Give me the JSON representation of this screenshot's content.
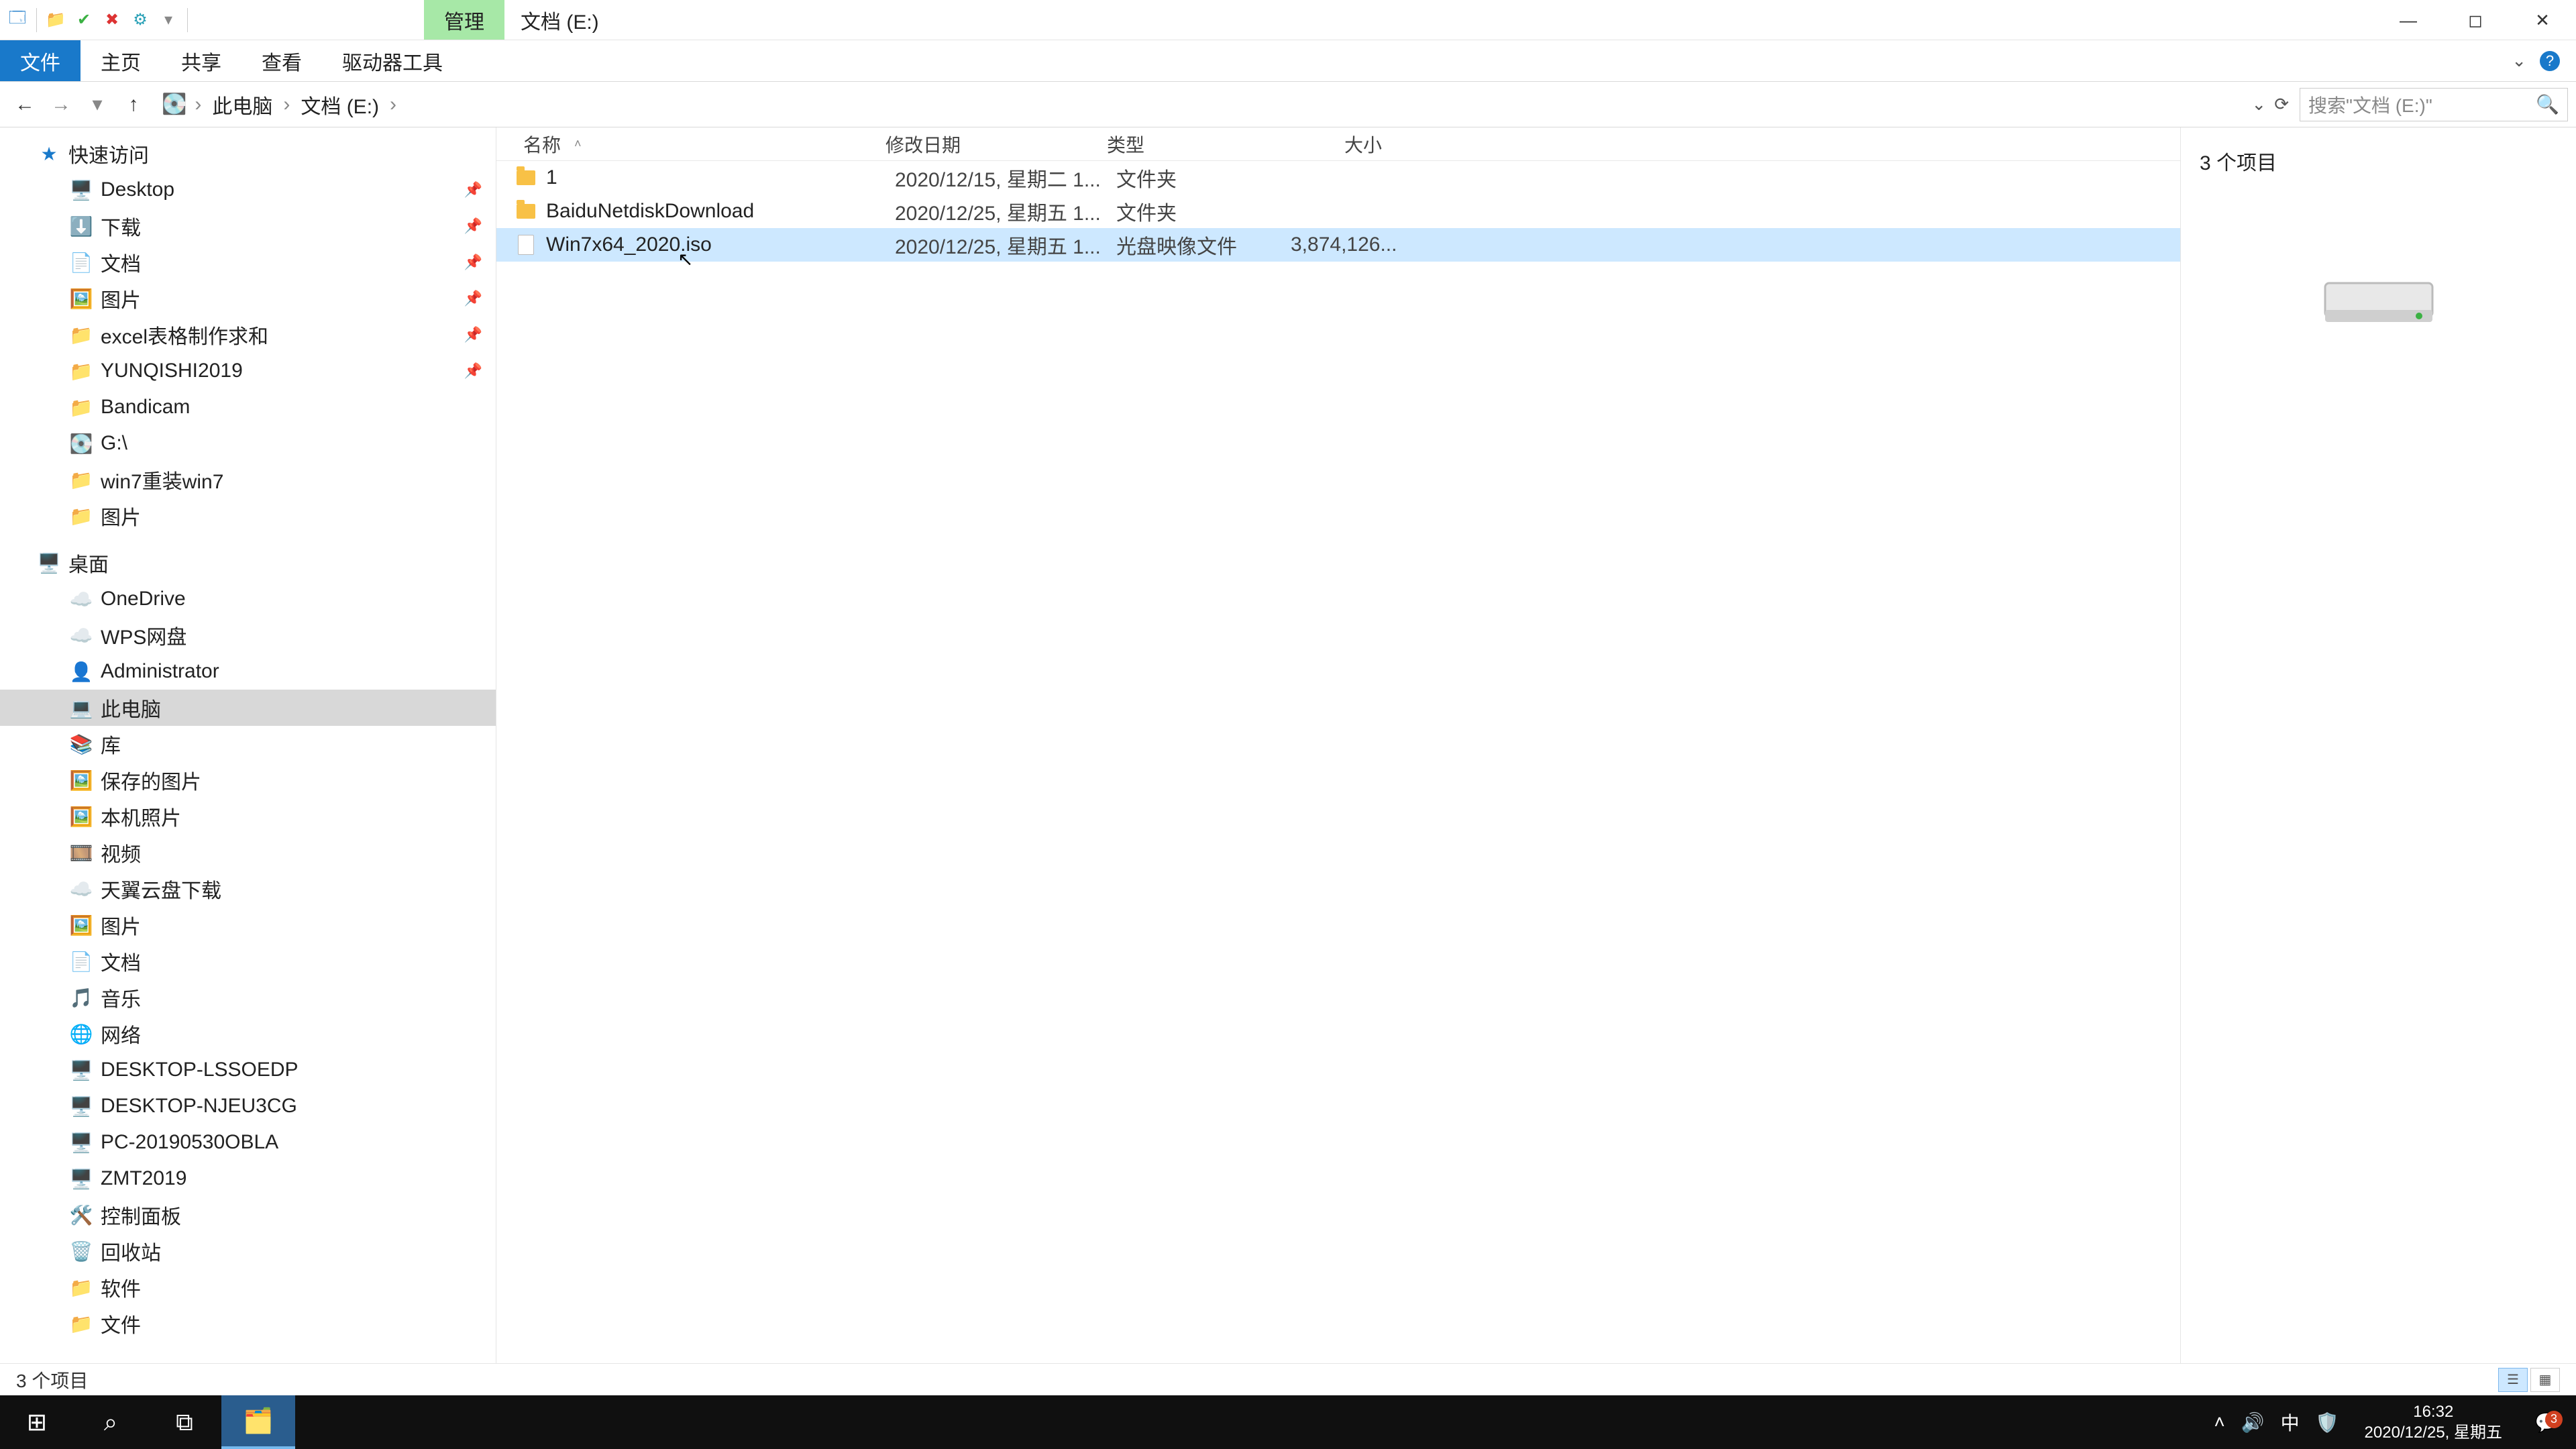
{
  "titlebar": {
    "context_tab": "管理",
    "location": "文档 (E:)"
  },
  "ribbon": {
    "file": "文件",
    "tabs": [
      "主页",
      "共享",
      "查看",
      "驱动器工具"
    ]
  },
  "nav": {
    "crumbs": [
      "此电脑",
      "文档 (E:)"
    ]
  },
  "search": {
    "placeholder": "搜索\"文档 (E:)\""
  },
  "tree": {
    "quick_access": "快速访问",
    "qa_items": [
      {
        "label": "Desktop",
        "icon": "🖥️",
        "pinned": true
      },
      {
        "label": "下载",
        "icon": "⬇️",
        "pinned": true
      },
      {
        "label": "文档",
        "icon": "📄",
        "pinned": true
      },
      {
        "label": "图片",
        "icon": "🖼️",
        "pinned": true
      },
      {
        "label": "excel表格制作求和",
        "icon": "📁",
        "pinned": true
      },
      {
        "label": "YUNQISHI2019",
        "icon": "📁",
        "pinned": true
      },
      {
        "label": "Bandicam",
        "icon": "📁",
        "pinned": false
      },
      {
        "label": "G:\\",
        "icon": "💽",
        "pinned": false
      },
      {
        "label": "win7重装win7",
        "icon": "📁",
        "pinned": false
      },
      {
        "label": "图片",
        "icon": "📁",
        "pinned": false
      }
    ],
    "desktop": "桌面",
    "desktop_items": [
      {
        "label": "OneDrive",
        "icon": "☁️"
      },
      {
        "label": "WPS网盘",
        "icon": "☁️"
      },
      {
        "label": "Administrator",
        "icon": "👤"
      },
      {
        "label": "此电脑",
        "icon": "💻",
        "selected": true
      },
      {
        "label": "库",
        "icon": "📚"
      }
    ],
    "lib_items": [
      {
        "label": "保存的图片",
        "icon": "🖼️"
      },
      {
        "label": "本机照片",
        "icon": "🖼️"
      },
      {
        "label": "视频",
        "icon": "🎞️"
      },
      {
        "label": "天翼云盘下载",
        "icon": "☁️"
      },
      {
        "label": "图片",
        "icon": "🖼️"
      },
      {
        "label": "文档",
        "icon": "📄"
      },
      {
        "label": "音乐",
        "icon": "🎵"
      }
    ],
    "network": "网络",
    "net_items": [
      {
        "label": "DESKTOP-LSSOEDP",
        "icon": "🖥️"
      },
      {
        "label": "DESKTOP-NJEU3CG",
        "icon": "🖥️"
      },
      {
        "label": "PC-20190530OBLA",
        "icon": "🖥️"
      },
      {
        "label": "ZMT2019",
        "icon": "🖥️"
      }
    ],
    "others": [
      {
        "label": "控制面板",
        "icon": "🛠️"
      },
      {
        "label": "回收站",
        "icon": "🗑️"
      },
      {
        "label": "软件",
        "icon": "📁"
      },
      {
        "label": "文件",
        "icon": "📁"
      }
    ]
  },
  "columns": {
    "name": "名称",
    "date": "修改日期",
    "type": "类型",
    "size": "大小"
  },
  "files": [
    {
      "name": "1",
      "date": "2020/12/15, 星期二 1...",
      "type": "文件夹",
      "size": "",
      "kind": "folder"
    },
    {
      "name": "BaiduNetdiskDownload",
      "date": "2020/12/25, 星期五 1...",
      "type": "文件夹",
      "size": "",
      "kind": "folder"
    },
    {
      "name": "Win7x64_2020.iso",
      "date": "2020/12/25, 星期五 1...",
      "type": "光盘映像文件",
      "size": "3,874,126...",
      "kind": "iso",
      "selected": true
    }
  ],
  "preview": {
    "count": "3 个项目"
  },
  "status": {
    "text": "3 个项目"
  },
  "tray": {
    "ime": "中",
    "time": "16:32",
    "date": "2020/12/25, 星期五",
    "notif_count": "3"
  }
}
